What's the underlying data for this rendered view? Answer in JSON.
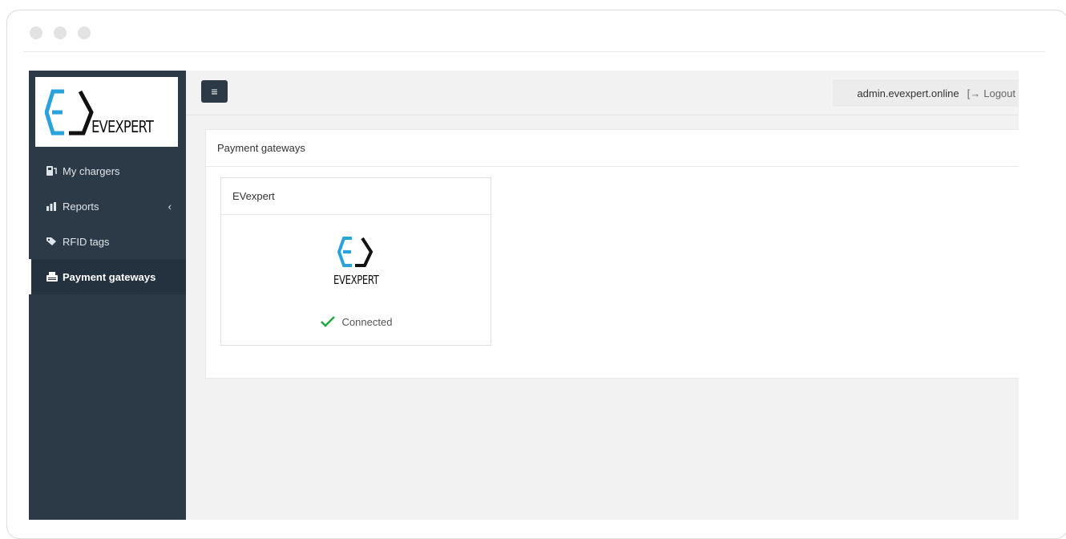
{
  "brand": {
    "logo_text": "EVEXPERT"
  },
  "sidebar": {
    "items": [
      {
        "label": "My chargers",
        "icon": "charger-icon"
      },
      {
        "label": "Reports",
        "icon": "bar-chart-icon"
      },
      {
        "label": "RFID tags",
        "icon": "tags-icon"
      },
      {
        "label": "Payment gateways",
        "icon": "payment-icon",
        "active": true
      }
    ]
  },
  "topbar": {
    "menu_icon": "≡",
    "user": "admin.evexpert.online",
    "logout_label": "Logout"
  },
  "main": {
    "title": "Payment gateways",
    "gateway": {
      "name": "EVexpert",
      "logo_text": "EVEXPERT",
      "status": "Connected"
    }
  },
  "colors": {
    "sidebar_bg": "#2c3a48",
    "logo_blue": "#2aa3dc",
    "status_green": "#27a744"
  }
}
